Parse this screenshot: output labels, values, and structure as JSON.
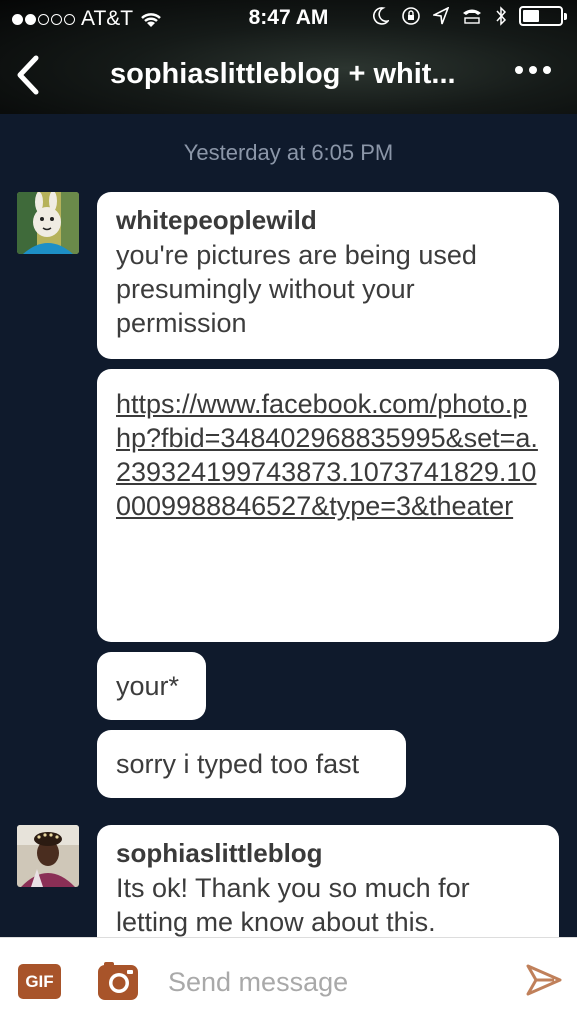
{
  "status_bar": {
    "carrier": "AT&T",
    "time": "8:47 AM"
  },
  "header": {
    "title": "sophiaslittleblog + whit..."
  },
  "conversation": {
    "date_separator": "Yesterday at 6:05 PM",
    "messages": [
      {
        "sender": "whitepeoplewild",
        "text": "you're pictures are being used presumingly without your permission"
      },
      {
        "link": "https://www.facebook.com/photo.php?fbid=348402968835995&set=a.239324199743873.1073741829.100009988846527&type=3&theater"
      },
      {
        "text": "your*"
      },
      {
        "text": "sorry i typed too fast"
      },
      {
        "sender": "sophiaslittleblog",
        "text": "Its ok! Thank you so much for letting me know about this."
      }
    ]
  },
  "composer": {
    "gif_label": "GIF",
    "placeholder": "Send message"
  },
  "colors": {
    "background": "#0f1a2c",
    "accent": "#a8542a"
  }
}
